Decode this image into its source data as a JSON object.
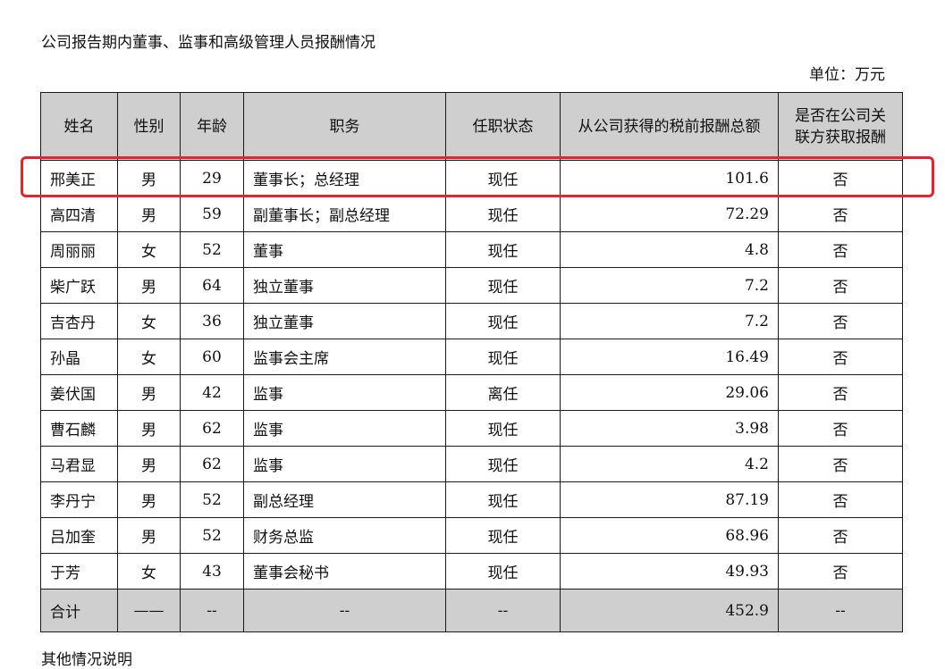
{
  "heading": "公司报告期内董事、监事和高级管理人员报酬情况",
  "unit": "单位：万元",
  "headers": [
    "姓名",
    "性别",
    "年龄",
    "职务",
    "任职状态",
    "从公司获得的税前报酬总额",
    "是否在公司关联方获取报酬"
  ],
  "rows": [
    [
      "邢美正",
      "男",
      "29",
      "董事长；总经理",
      "现任",
      "101.6",
      "否"
    ],
    [
      "高四清",
      "男",
      "59",
      "副董事长；副总经理",
      "现任",
      "72.29",
      "否"
    ],
    [
      "周丽丽",
      "女",
      "52",
      "董事",
      "现任",
      "4.8",
      "否"
    ],
    [
      "柴广跃",
      "男",
      "64",
      "独立董事",
      "现任",
      "7.2",
      "否"
    ],
    [
      "吉杏丹",
      "女",
      "36",
      "独立董事",
      "现任",
      "7.2",
      "否"
    ],
    [
      "孙晶",
      "女",
      "60",
      "监事会主席",
      "现任",
      "16.49",
      "否"
    ],
    [
      "姜伏国",
      "男",
      "42",
      "监事",
      "离任",
      "29.06",
      "否"
    ],
    [
      "曹石麟",
      "男",
      "62",
      "监事",
      "现任",
      "3.98",
      "否"
    ],
    [
      "马君显",
      "男",
      "62",
      "监事",
      "现任",
      "4.2",
      "否"
    ],
    [
      "李丹宁",
      "男",
      "52",
      "副总经理",
      "现任",
      "87.19",
      "否"
    ],
    [
      "吕加奎",
      "男",
      "52",
      "财务总监",
      "现任",
      "68.96",
      "否"
    ],
    [
      "于芳",
      "女",
      "43",
      "董事会秘书",
      "现任",
      "49.93",
      "否"
    ]
  ],
  "total": [
    "合计",
    "——",
    "--",
    "--",
    "--",
    "452.9",
    "--"
  ],
  "footer_note": "其他情况说明",
  "highlight_color": "#e8232a"
}
